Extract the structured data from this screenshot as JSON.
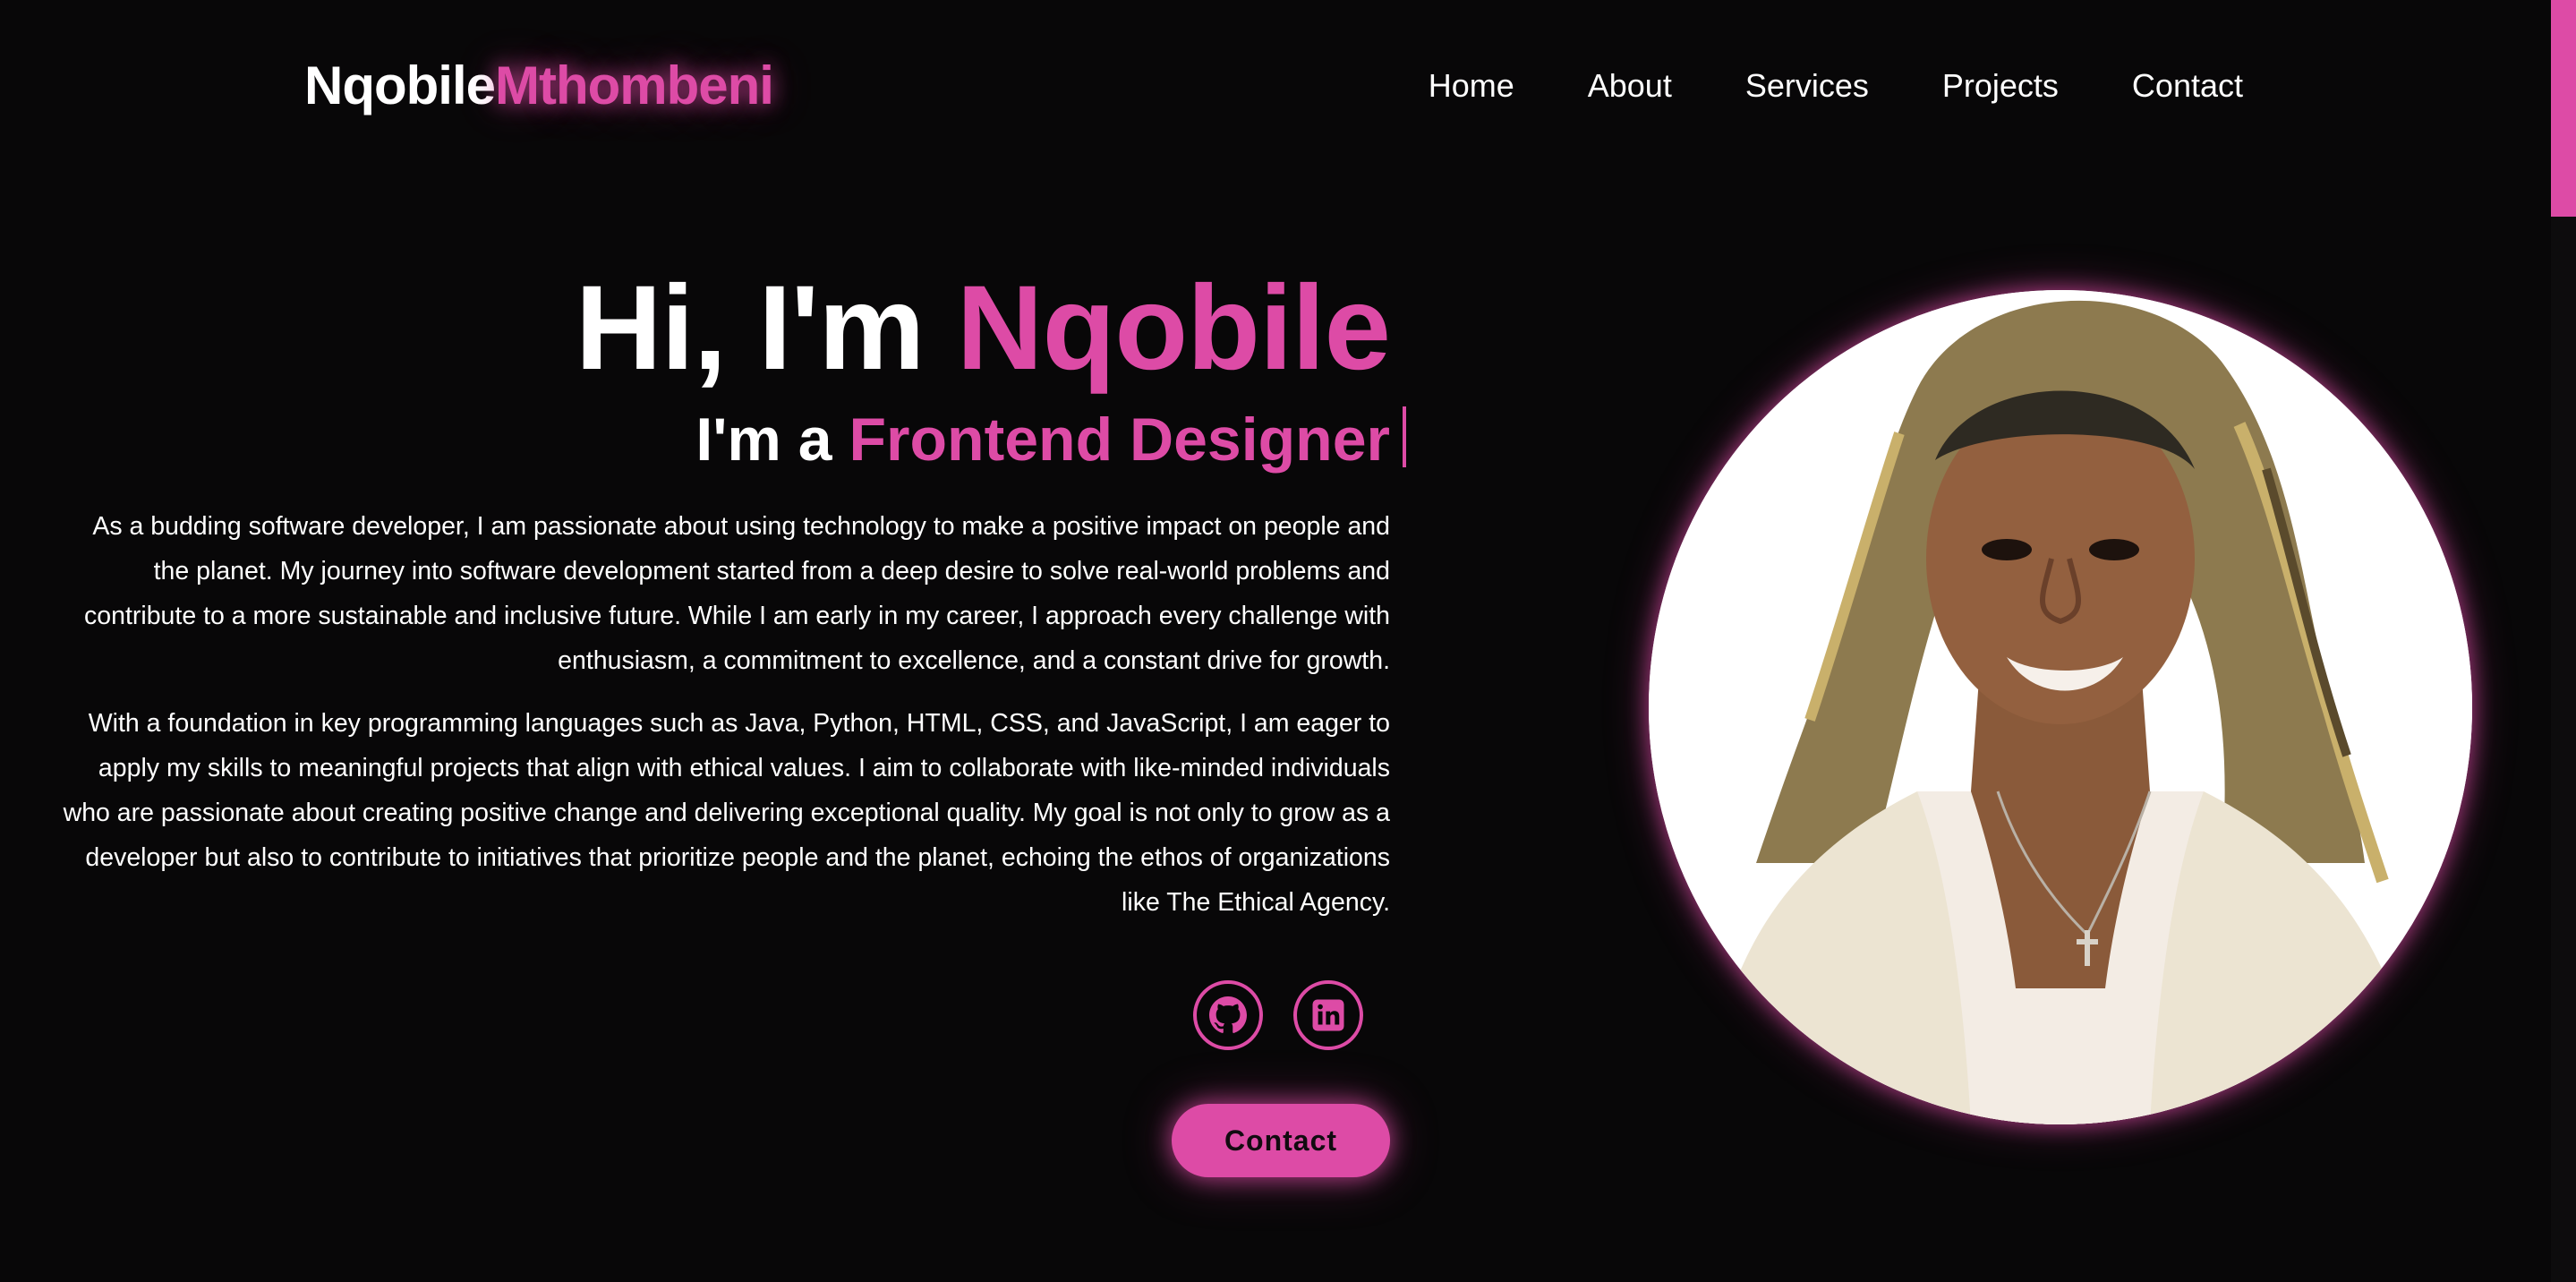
{
  "brand": {
    "first": "Nqobile",
    "last": "Mthombeni"
  },
  "nav": {
    "items": [
      {
        "label": "Home"
      },
      {
        "label": "About"
      },
      {
        "label": "Services"
      },
      {
        "label": "Projects"
      },
      {
        "label": "Contact"
      }
    ]
  },
  "hero": {
    "greeting": "Hi, I'm ",
    "name": "Nqobile",
    "role_prefix": "I'm a ",
    "role": "Frontend Designer",
    "paragraphs": [
      "As a budding software developer, I am passionate about using technology to make a positive impact on people and the planet. My journey into software development started from a deep desire to solve real-world problems and contribute to a more sustainable and inclusive future. While I am early in my career, I approach every challenge with enthusiasm, a commitment to excellence, and a constant drive for growth.",
      "With a foundation in key programming languages such as Java, Python, HTML, CSS, and JavaScript, I am eager to apply my skills to meaningful projects that align with ethical values. I aim to collaborate with like-minded individuals who are passionate about creating positive change and delivering exceptional quality. My goal is not only to grow as a developer but also to contribute to initiatives that prioritize people and the planet, echoing the ethos of organizations like The Ethical Agency."
    ],
    "socials": [
      {
        "icon": "github-icon"
      },
      {
        "icon": "linkedin-icon"
      }
    ],
    "contact_button": "Contact"
  },
  "portrait": {
    "subject": "profile-photo"
  },
  "colors": {
    "accent": "#dd4ba6",
    "background": "#080708",
    "text": "#ffffff"
  }
}
